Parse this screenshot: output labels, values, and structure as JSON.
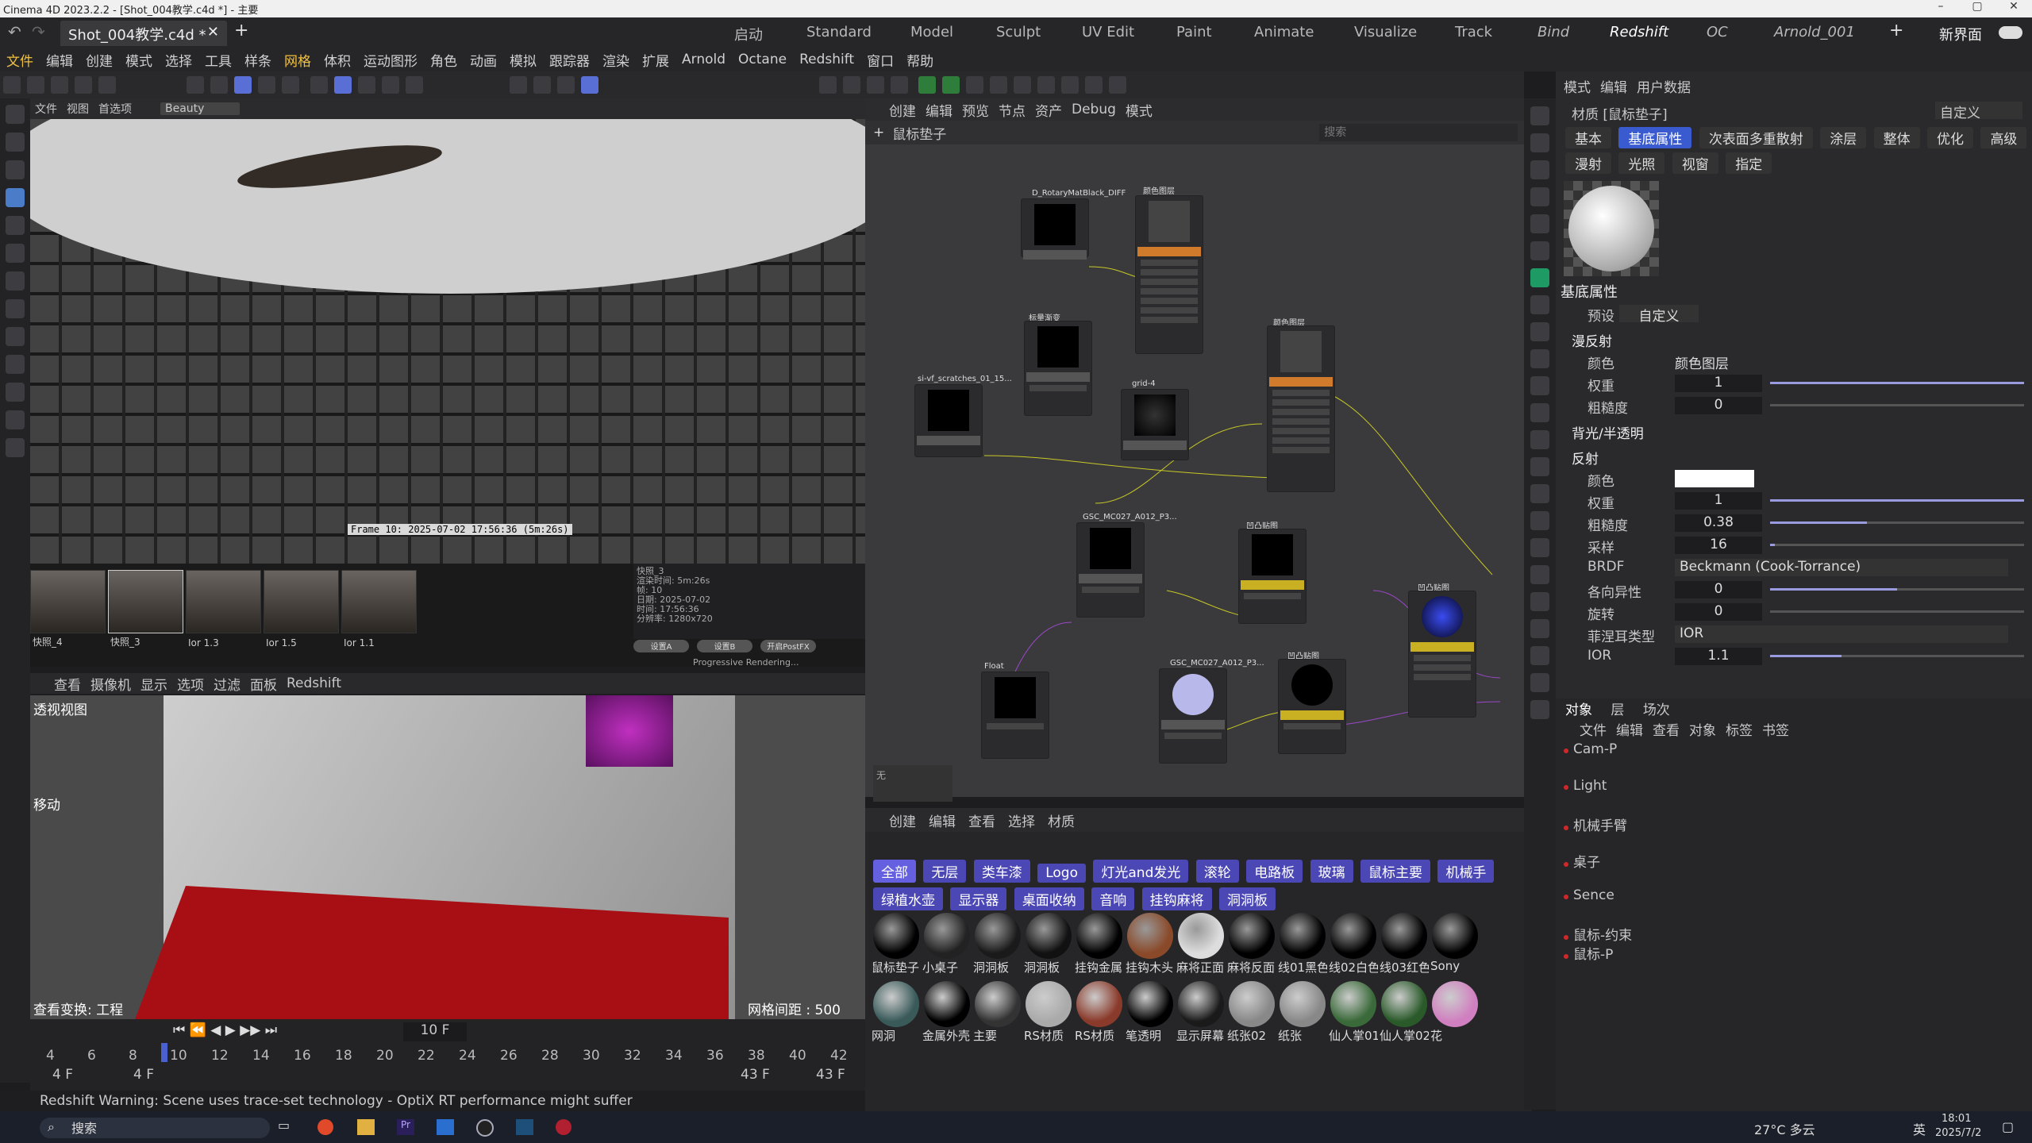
{
  "window": {
    "title": "Cinema 4D 2023.2.2 - [Shot_004教学.c4d *] - 主要",
    "doc_tab": "Shot_004教学.c4d *",
    "new_interface": "新界面"
  },
  "layouts": [
    "启动",
    "Standard",
    "Model",
    "Sculpt",
    "UV Edit",
    "Paint",
    "Animate",
    "Visualize",
    "Track",
    "Bind",
    "Redshift",
    "OC",
    "Arnold_001"
  ],
  "active_layout": "Redshift",
  "menu": [
    "文件",
    "编辑",
    "创建",
    "模式",
    "选择",
    "工具",
    "样条",
    "网格",
    "体积",
    "运动图形",
    "角色",
    "动画",
    "模拟",
    "跟踪器",
    "渲染",
    "扩展",
    "Arnold",
    "Octane",
    "Redshift",
    "窗口",
    "帮助"
  ],
  "render_view": {
    "menu": [
      "文件",
      "视图",
      "首选项"
    ],
    "beauty": "Beauty",
    "frame_text": "Frame  10: 2025-07-02  17:56:36  (5m:26s)",
    "snapshots": [
      "快照_4",
      "快照_3",
      "Ior 1.3",
      "Ior 1.5",
      "Ior 1.1"
    ],
    "snapshot_panel": {
      "name": "快照_3",
      "lines": [
        "渲染时间: 5m:26s",
        "帧: 10",
        "日期: 2025-07-02",
        "时间: 17:56:36",
        "分辨率: 1280x720"
      ]
    },
    "buttons": [
      "设置A",
      "设置B",
      "开启PostFX"
    ],
    "status": "Progressive Rendering..."
  },
  "viewport": {
    "menu": [
      "查看",
      "摄像机",
      "显示",
      "选项",
      "过滤",
      "面板",
      "Redshift"
    ],
    "label": "透视视图",
    "tool": "移动",
    "bottom_left": "查看变换: 工程",
    "grid_spacing": "网格间距 : 500 cm"
  },
  "timeline": {
    "current_frame": "10 F",
    "ticks": [
      "4",
      "6",
      "8",
      "10",
      "12",
      "14",
      "16",
      "18",
      "20",
      "22",
      "24",
      "26",
      "28",
      "30",
      "32",
      "34",
      "36",
      "38",
      "40",
      "42"
    ],
    "start_a": "4 F",
    "start_b": "4 F",
    "end_a": "43 F",
    "end_b": "43 F"
  },
  "status_line": "Redshift Warning: Scene uses trace-set technology - OptiX RT performance might suffer",
  "node_editor": {
    "menu": [
      "创建",
      "编辑",
      "预览",
      "节点",
      "资产",
      "Debug",
      "模式"
    ],
    "path": "鼠标垫子",
    "search_placeholder": "搜索",
    "empty": "无",
    "nodes": [
      "D_RotaryMatBlack_DIFF",
      "颜色图层",
      "si-vf_scratches_01_15...",
      "标量渐变",
      "grid-4",
      "颜色图层",
      "GSC_MC027_A012_P3...",
      "凹凸贴图",
      "GSC_MC027_A012_P3...",
      "凹凸贴图",
      "凹凸贴图",
      "Float"
    ]
  },
  "material_manager": {
    "menu": [
      "创建",
      "编辑",
      "查看",
      "选择",
      "材质"
    ],
    "categories": [
      "全部",
      "无层",
      "类车漆",
      "Logo",
      "灯光and发光",
      "滚轮",
      "电路板",
      "玻璃",
      "鼠标主要",
      "机械手",
      "绿植水壶",
      "显示器",
      "桌面收纳",
      "音响",
      "挂钩麻将",
      "洞洞板"
    ],
    "materials_row1": [
      "鼠标垫子",
      "小桌子",
      "洞洞板",
      "洞洞板",
      "挂钩金属",
      "挂钩木头",
      "麻将正面",
      "麻将反面",
      "线01黑色",
      "线02白色",
      "线03红色",
      "Sony"
    ],
    "materials_row2": [
      "网洞",
      "金属外壳",
      "主要",
      "RS材质",
      "RS材质",
      "笔透明",
      "显示屏幕",
      "纸张02",
      "纸张",
      "仙人掌01",
      "仙人掌02",
      "花"
    ]
  },
  "attributes": {
    "menu": [
      "模式",
      "编辑",
      "用户数据"
    ],
    "material_title": "材质 [鼠标垫子]",
    "preset_dropdown": "自定义",
    "tabs_row1": [
      "基本",
      "基底属性",
      "次表面多重散射",
      "涂层",
      "整体",
      "优化",
      "高级"
    ],
    "tabs_row2": [
      "漫射",
      "光照",
      "视窗",
      "指定"
    ],
    "active_tab": "基底属性",
    "section": "基底属性",
    "preset_label": "预设",
    "preset_value": "自定义",
    "diffuse": {
      "title": "漫反射",
      "color_label": "颜色",
      "color_value": "颜色图层",
      "weight_label": "权重",
      "weight": "1",
      "rough_label": "粗糙度",
      "rough": "0"
    },
    "backlight": "背光/半透明",
    "reflection": {
      "title": "反射",
      "color_label": "颜色",
      "weight_label": "权重",
      "weight": "1",
      "rough_label": "粗糙度",
      "rough": "0.38",
      "samples_label": "采样",
      "samples": "16",
      "brdf_label": "BRDF",
      "brdf": "Beckmann (Cook-Torrance)",
      "aniso_label": "各向异性",
      "aniso": "0",
      "rotation_label": "旋转",
      "rotation": "0",
      "fresnel_label": "菲涅耳类型",
      "fresnel": "IOR",
      "ior_label": "IOR",
      "ior": "1.1"
    }
  },
  "objects": {
    "tabs": [
      "对象",
      "层",
      "场次"
    ],
    "menu": [
      "文件",
      "编辑",
      "查看",
      "对象",
      "标签",
      "书签"
    ],
    "items": [
      "Cam-P",
      "Light",
      "机械手臂",
      "桌子",
      "Sence",
      "鼠标-约束",
      "鼠标-P"
    ]
  },
  "taskbar": {
    "search": "搜索",
    "weather": "27°C 多云",
    "lang": "英",
    "time": "18:01",
    "date": "2025/7/2"
  },
  "colors": {
    "accent": "#4b48b6",
    "layout_active": "#3a5bd0",
    "node_orange": "#d07a2c",
    "node_yellow": "#c8b022",
    "floor_red": "#a80f14"
  }
}
